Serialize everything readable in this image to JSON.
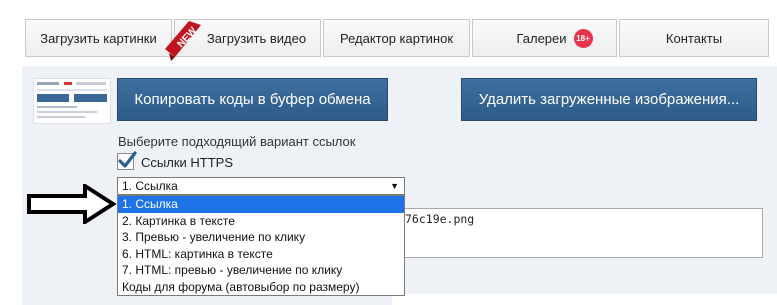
{
  "nav": {
    "tabs": [
      {
        "label": "Загрузить картинки"
      },
      {
        "label": "Загрузить видео",
        "ribbon": "NEW"
      },
      {
        "label": "Редактор картинок"
      },
      {
        "label": "Галереи",
        "badge": "18+"
      },
      {
        "label": "Контакты"
      }
    ]
  },
  "buttons": {
    "copy_label": "Копировать коды в буфер обмена",
    "delete_label": "Удалить загруженные изображения..."
  },
  "form": {
    "hint": "Выберите подходящий вариант ссылок",
    "https_label": "Ссылки HTTPS",
    "https_checked": true,
    "select_value": "1. Ссылка",
    "options": [
      "1. Ссылка",
      "2. Картинка в тексте",
      "3. Превью - увеличение по клику",
      "6. HTML: картинка в тексте",
      "7. HTML: превью - увеличение по клику",
      "Коды для форума (автовыбор по размеру)"
    ],
    "selected_index": 0,
    "code_fragment": "76c19e.png"
  },
  "colors": {
    "button_bg": "#2f5f8e",
    "badge_bg": "#e8334a",
    "option_highlight": "#1e73e8",
    "panel_bg": "#eef1f6"
  }
}
